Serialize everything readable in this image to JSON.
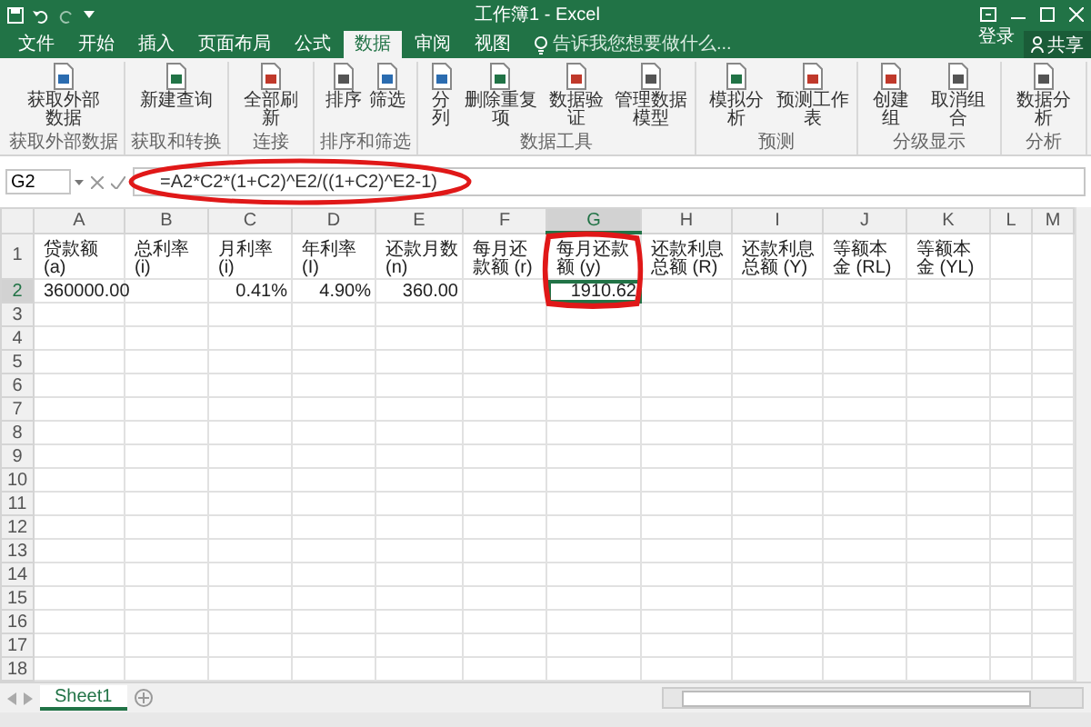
{
  "window": {
    "title": "工作簿1 - Excel"
  },
  "account": {
    "sign_in": "登录",
    "share": "共享"
  },
  "tabs": [
    {
      "label": "文件",
      "selected": false
    },
    {
      "label": "开始",
      "selected": false
    },
    {
      "label": "插入",
      "selected": false
    },
    {
      "label": "页面布局",
      "selected": false
    },
    {
      "label": "公式",
      "selected": false
    },
    {
      "label": "数据",
      "selected": true
    },
    {
      "label": "审阅",
      "selected": false
    },
    {
      "label": "视图",
      "selected": false
    }
  ],
  "tell_me": {
    "placeholder": "告诉我您想要做什么..."
  },
  "ribbon": {
    "groups": [
      {
        "label": "获取外部数据",
        "buttons": [
          "获取外部数据"
        ]
      },
      {
        "label": "获取和转换",
        "buttons": [
          "新建查询"
        ]
      },
      {
        "label": "连接",
        "buttons": [
          "全部刷新"
        ]
      },
      {
        "label": "排序和筛选",
        "buttons": [
          "排序",
          "筛选"
        ]
      },
      {
        "label": "数据工具",
        "buttons": [
          "分列",
          "删除重复项",
          "数据验证",
          "管理数据模型"
        ]
      },
      {
        "label": "预测",
        "buttons": [
          "模拟分析",
          "预测工作表"
        ]
      },
      {
        "label": "分级显示",
        "buttons": [
          "创建组",
          "取消组合"
        ]
      },
      {
        "label": "分析",
        "buttons": [
          "数据分析"
        ]
      }
    ]
  },
  "formula_bar": {
    "name_box": "G2",
    "formula": "=A2*C2*(1+C2)^E2/((1+C2)^E2-1)"
  },
  "highlights": {
    "formula_circled": true,
    "cell_circled": true
  },
  "sheet": {
    "columns": [
      {
        "label": "A",
        "selected": false
      },
      {
        "label": "B",
        "selected": false
      },
      {
        "label": "C",
        "selected": false
      },
      {
        "label": "D",
        "selected": false
      },
      {
        "label": "E",
        "selected": false
      },
      {
        "label": "F",
        "selected": false
      },
      {
        "label": "G",
        "selected": true
      },
      {
        "label": "H",
        "selected": false
      },
      {
        "label": "I",
        "selected": false
      },
      {
        "label": "J",
        "selected": false
      },
      {
        "label": "K",
        "selected": false
      },
      {
        "label": "L",
        "selected": false
      },
      {
        "label": "M",
        "selected": false
      }
    ],
    "rows": [
      {
        "number": "1",
        "selected": false,
        "cells": [
          "贷款额(a)",
          "总利率 (i)",
          "月利率 (i)",
          "年利率 (I)",
          "还款月数 (n)",
          "每月还款额 (r)",
          "每月还款额 (y)",
          "还款利息总额 (R)",
          "还款利息总额 (Y)",
          "等额本金 (RL)",
          "等额本金 (YL)",
          "",
          ""
        ]
      },
      {
        "number": "2",
        "selected": true,
        "cells": [
          "360000.00",
          "",
          "0.41%",
          "4.90%",
          "360.00",
          "",
          "1910.62",
          "",
          "",
          "",
          "",
          "",
          ""
        ]
      },
      {
        "number": "3",
        "selected": false
      },
      {
        "number": "4",
        "selected": false
      },
      {
        "number": "5",
        "selected": false
      },
      {
        "number": "6",
        "selected": false
      },
      {
        "number": "7",
        "selected": false
      },
      {
        "number": "8",
        "selected": false
      },
      {
        "number": "9",
        "selected": false
      },
      {
        "number": "10",
        "selected": false
      },
      {
        "number": "11",
        "selected": false
      },
      {
        "number": "12",
        "selected": false
      },
      {
        "number": "13",
        "selected": false
      },
      {
        "number": "14",
        "selected": false
      },
      {
        "number": "15",
        "selected": false
      },
      {
        "number": "16",
        "selected": false
      },
      {
        "number": "17",
        "selected": false
      },
      {
        "number": "18",
        "selected": false
      }
    ]
  },
  "sheet_tabs": [
    {
      "label": "Sheet1",
      "selected": true
    }
  ]
}
